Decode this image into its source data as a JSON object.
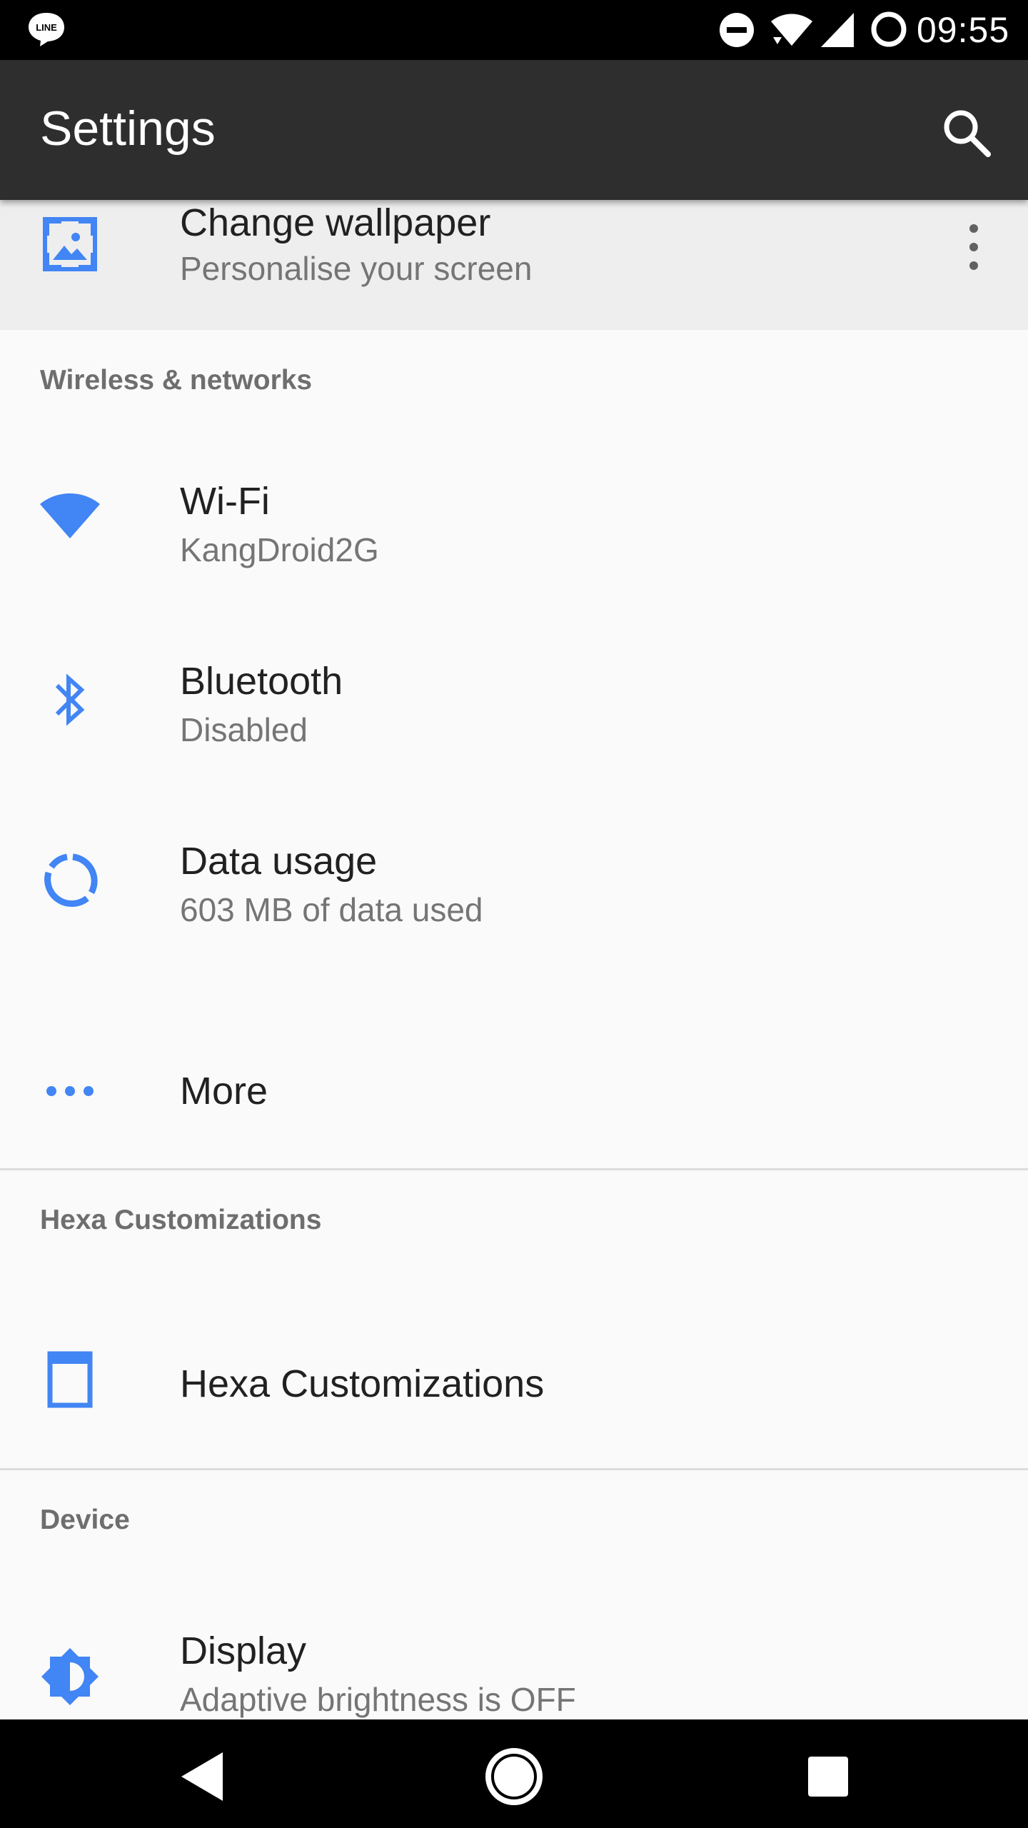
{
  "status_bar": {
    "time": "09:55",
    "icons": [
      "line-app-icon",
      "do-not-disturb-icon",
      "wifi-icon",
      "signal-icon",
      "battery-icon"
    ]
  },
  "app_bar": {
    "title": "Settings",
    "search_icon": "search-icon"
  },
  "suggestion": {
    "title": "Change wallpaper",
    "summary": "Personalise your screen",
    "icon": "wallpaper-icon",
    "menu_icon": "more-vert-icon"
  },
  "sections": {
    "wireless": {
      "header": "Wireless & networks",
      "items": [
        {
          "title": "Wi-Fi",
          "summary": "KangDroid2G",
          "icon": "wifi-icon"
        },
        {
          "title": "Bluetooth",
          "summary": "Disabled",
          "icon": "bluetooth-icon"
        },
        {
          "title": "Data usage",
          "summary": "603 MB of data used",
          "icon": "data-usage-icon"
        },
        {
          "title": "More",
          "icon": "more-horiz-icon"
        }
      ]
    },
    "hexa": {
      "header": "Hexa Customizations",
      "items": [
        {
          "title": "Hexa Customizations",
          "icon": "hexa-window-icon"
        }
      ]
    },
    "device": {
      "header": "Device",
      "items": [
        {
          "title": "Display",
          "summary": "Adaptive brightness is OFF",
          "icon": "brightness-icon"
        }
      ]
    }
  },
  "nav_bar": {
    "buttons": [
      "back-icon",
      "home-icon",
      "recents-icon"
    ]
  },
  "colors": {
    "accent": "#4285f4",
    "app_bar": "#2e2e2e",
    "background": "#fafafa",
    "suggestion_bg": "#eeeeee"
  }
}
